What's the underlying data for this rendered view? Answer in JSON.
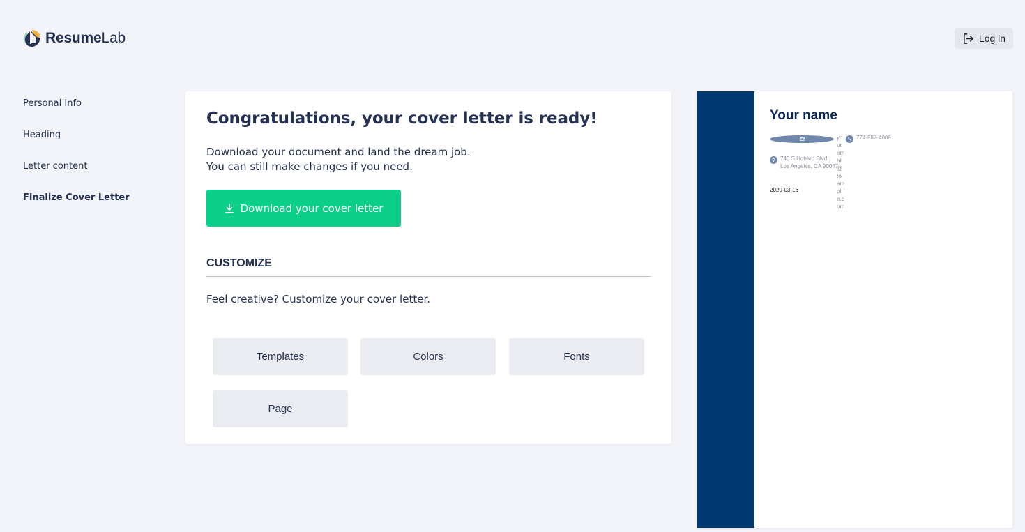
{
  "header": {
    "logo": {
      "part1": "Resume",
      "part2": "Lab"
    },
    "login_label": "Log in"
  },
  "sidebar": {
    "items": [
      {
        "label": "Personal Info",
        "active": false
      },
      {
        "label": "Heading",
        "active": false
      },
      {
        "label": "Letter content",
        "active": false
      },
      {
        "label": "Finalize Cover Letter",
        "active": true
      }
    ]
  },
  "main": {
    "title": "Congratulations, your cover letter is ready!",
    "lead_line1": "Download your document and land the dream job.",
    "lead_line2": "You can still make changes if you need.",
    "download_label": "Download your cover letter",
    "customize_title": "CUSTOMIZE",
    "customize_subtitle": "Feel creative? Customize your cover letter.",
    "options": [
      {
        "label": "Templates"
      },
      {
        "label": "Colors"
      },
      {
        "label": "Fonts"
      },
      {
        "label": "Page"
      }
    ]
  },
  "preview": {
    "name": "Your name",
    "email": "your.email@example.com",
    "phone": "774-987-4008",
    "address_line1": "740 S Hobard Blvd",
    "address_line2": "Los Angeles, CA 90047",
    "date": "2020-03-16"
  },
  "colors": {
    "primary_text": "#253152",
    "accent_green": "#0ccf8a",
    "preview_sidebar": "#003870",
    "preview_name": "#0b2a5b",
    "background": "#f3f4f9",
    "option_button": "#eaecf1"
  }
}
